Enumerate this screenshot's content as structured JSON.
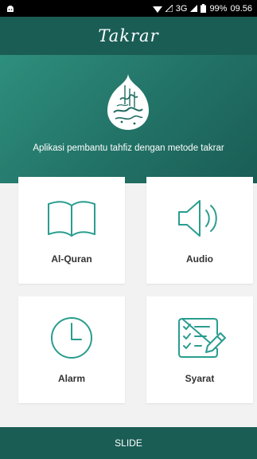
{
  "status_bar": {
    "network": "3G",
    "battery": "99%",
    "time": "09.56"
  },
  "header": {
    "title": "Takrar"
  },
  "hero": {
    "tagline": "Aplikasi pembantu tahfiz dengan metode takrar"
  },
  "menu": [
    {
      "label": "Al-Quran",
      "icon": "book-icon"
    },
    {
      "label": "Audio",
      "icon": "speaker-icon"
    },
    {
      "label": "Alarm",
      "icon": "clock-icon"
    },
    {
      "label": "Syarat",
      "icon": "checklist-icon"
    }
  ],
  "bottom_bar": {
    "label": "SLIDE"
  },
  "colors": {
    "primary": "#1a5d55",
    "accent": "#2e8f7d",
    "icon": "#2a9d8f"
  }
}
